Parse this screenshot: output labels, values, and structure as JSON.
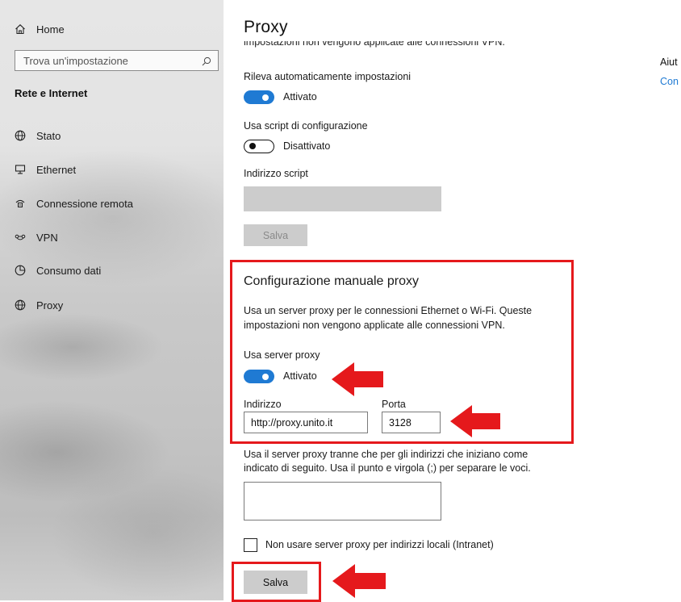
{
  "sidebar": {
    "home": "Home",
    "search_placeholder": "Trova un'impostazione",
    "section": "Rete e Internet",
    "items": [
      {
        "label": "Stato",
        "icon": "globe-icon"
      },
      {
        "label": "Ethernet",
        "icon": "ethernet-icon"
      },
      {
        "label": "Connessione remota",
        "icon": "phone-icon"
      },
      {
        "label": "VPN",
        "icon": "vpn-icon"
      },
      {
        "label": "Consumo dati",
        "icon": "data-usage-icon"
      },
      {
        "label": "Proxy",
        "icon": "globe-icon"
      }
    ]
  },
  "main": {
    "title": "Proxy",
    "cut_text": "impostazioni non vengono applicate alle connessioni VPN.",
    "auto_detect": {
      "label": "Rileva automaticamente impostazioni",
      "state": "Attivato"
    },
    "use_script": {
      "label": "Usa script di configurazione",
      "state": "Disattivato"
    },
    "script_address_label": "Indirizzo script",
    "save_disabled": "Salva",
    "manual": {
      "title": "Configurazione manuale proxy",
      "description_line1": "Usa un server proxy per le connessioni Ethernet o Wi-Fi. Queste",
      "description_line2": "impostazioni non vengono applicate alle connessioni VPN.",
      "use_proxy_label": "Usa server proxy",
      "use_proxy_state": "Attivato",
      "address_label": "Indirizzo",
      "address_value": "http://proxy.unito.it",
      "port_label": "Porta",
      "port_value": "3128"
    },
    "exceptions_line1": "Usa il server proxy tranne che per gli indirizzi che iniziano come",
    "exceptions_line2": "indicato di seguito. Usa il punto e virgola (;) per separare le voci.",
    "local_checkbox_label": "Non usare server proxy per indirizzi locali (Intranet)",
    "save": "Salva"
  },
  "right": {
    "help_label": "Aiut",
    "help_link": "Con"
  },
  "colors": {
    "accent": "#1f7ad3",
    "annotation": "#e5191c"
  }
}
